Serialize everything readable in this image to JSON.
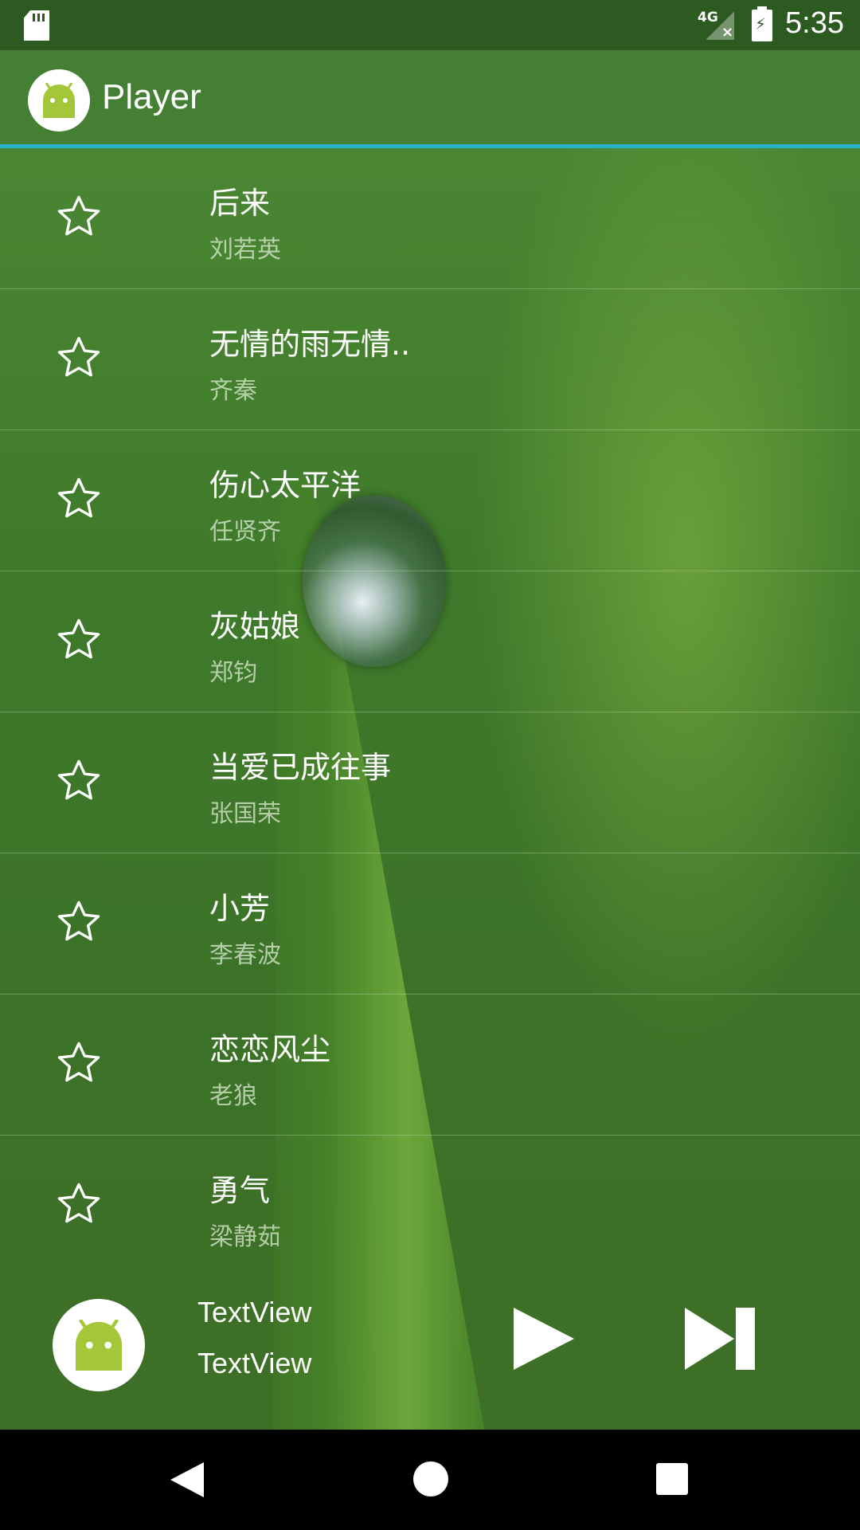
{
  "status_bar": {
    "network": "4G",
    "time": "5:35",
    "icons": [
      "sd-card-icon",
      "signal-no-service-icon",
      "battery-charging-icon"
    ]
  },
  "app_bar": {
    "title": "Player",
    "logo_icon": "android-icon",
    "accent_color": "#27b2c9"
  },
  "songs": [
    {
      "title": "后来",
      "artist": "刘若英"
    },
    {
      "title": "无情的雨无情..",
      "artist": "齐秦"
    },
    {
      "title": "伤心太平洋",
      "artist": "任贤齐"
    },
    {
      "title": "灰姑娘",
      "artist": "郑钧"
    },
    {
      "title": "当爱已成往事",
      "artist": "张国荣"
    },
    {
      "title": "小芳",
      "artist": "李春波"
    },
    {
      "title": "恋恋风尘",
      "artist": "老狼"
    },
    {
      "title": "勇气",
      "artist": "梁静茹"
    }
  ],
  "player": {
    "line1": "TextView",
    "line2": "TextView",
    "art_icon": "android-icon",
    "controls": [
      "play-icon",
      "skip-next-icon"
    ]
  },
  "nav_bar": {
    "buttons": [
      "back-icon",
      "home-icon",
      "recents-icon"
    ]
  }
}
